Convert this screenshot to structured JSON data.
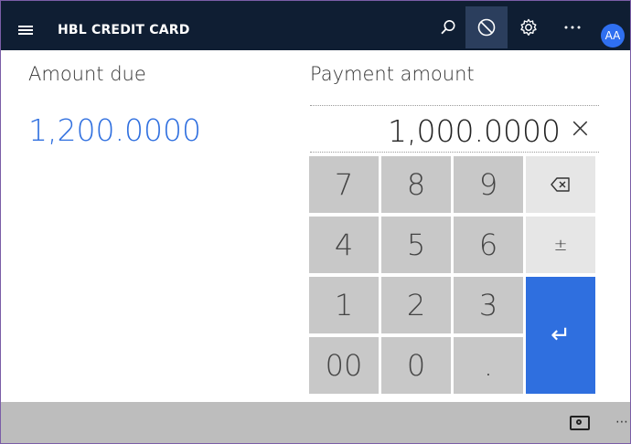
{
  "header": {
    "title": "HBL CREDIT CARD",
    "avatar_initials": "AA",
    "icons": [
      "menu-icon",
      "search-icon",
      "cancel-icon",
      "settings-icon",
      "more-icon"
    ]
  },
  "amount_due": {
    "label": "Amount due",
    "value": "1,200.0000"
  },
  "payment": {
    "label": "Payment amount",
    "value": "1,000.0000",
    "clear_glyph": "×"
  },
  "keypad": {
    "keys": [
      "7",
      "8",
      "9",
      "4",
      "5",
      "6",
      "1",
      "2",
      "3",
      "00",
      "0",
      "."
    ],
    "backspace_glyph": "⌫",
    "plusminus_glyph": "±",
    "enter_glyph": "↵"
  },
  "colors": {
    "header_bg": "#0f1e33",
    "accent": "#2f6fdf",
    "key_bg": "#c8c8c8",
    "key_light_bg": "#e6e6e6",
    "bottombar_bg": "#bdbdbd"
  }
}
